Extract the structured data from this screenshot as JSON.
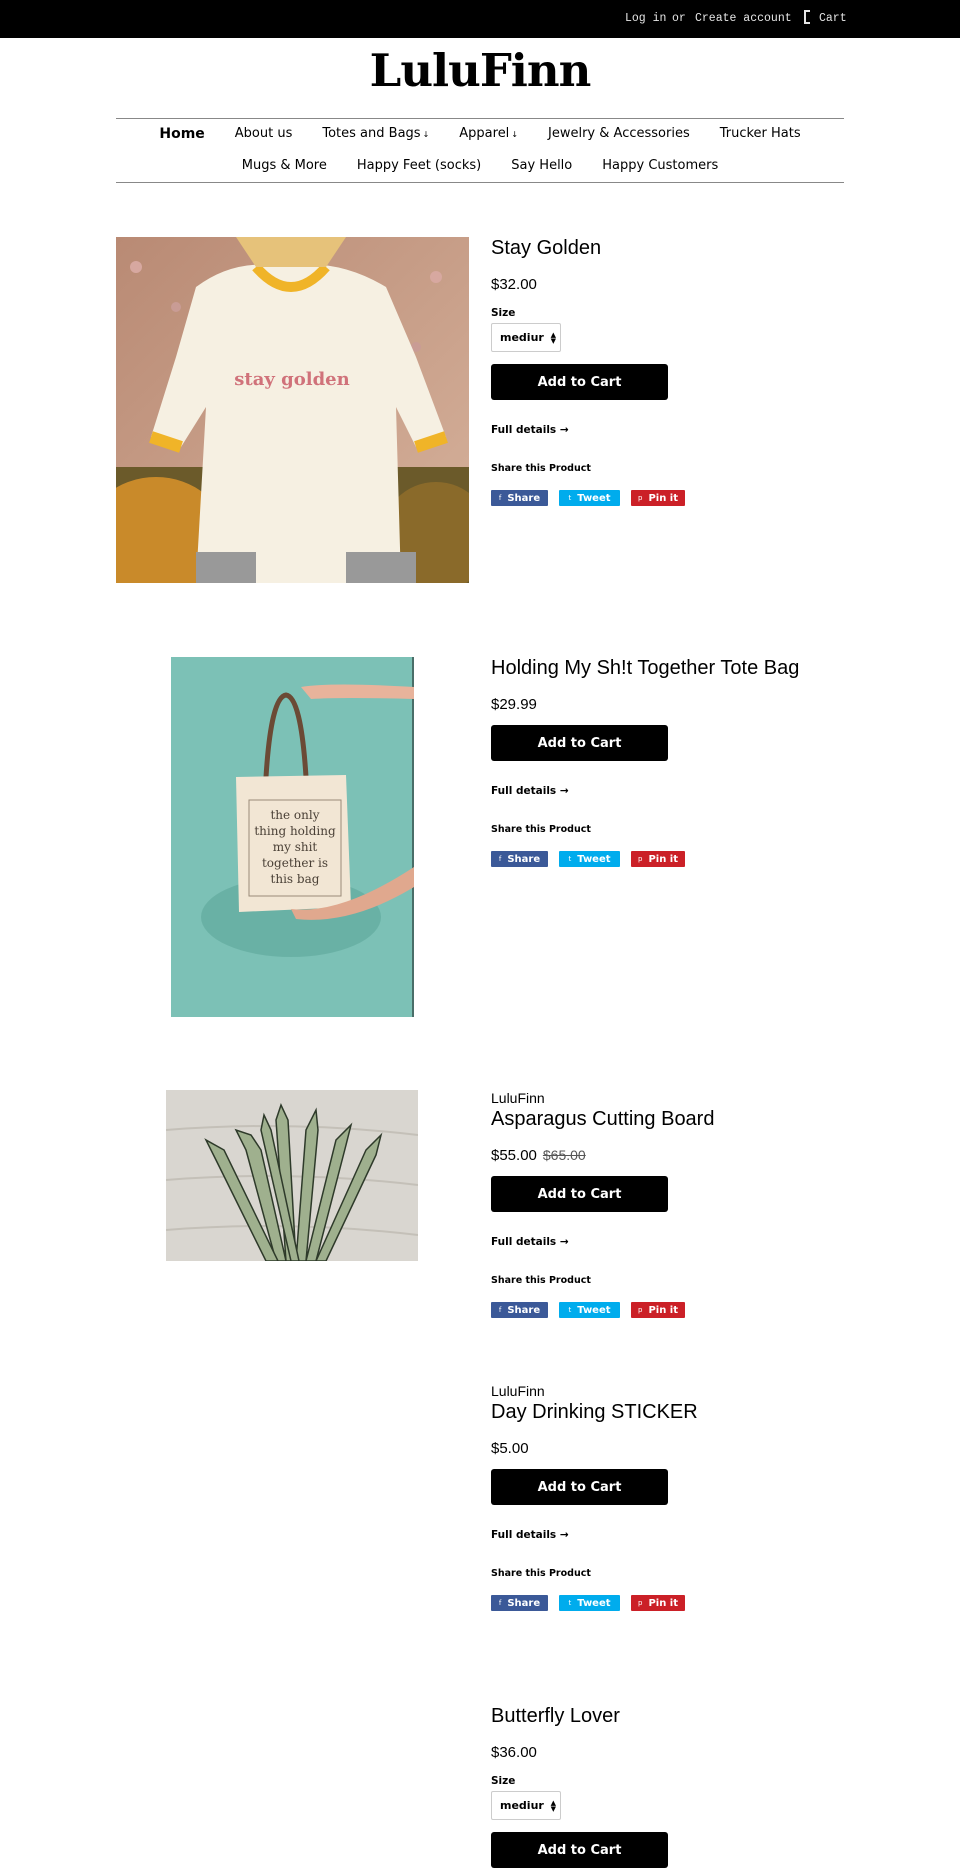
{
  "topbar": {
    "login_label": "Log in",
    "or_label": "or",
    "create_account_label": "Create account",
    "cart_label": "Cart",
    "cart_icon": "cart-bracket-icon"
  },
  "store": {
    "name": "LuluFinn"
  },
  "nav": {
    "row1": [
      {
        "label": "Home",
        "active": true,
        "dropdown": false
      },
      {
        "label": "About us",
        "dropdown": false
      },
      {
        "label": "Totes and Bags",
        "dropdown": true
      },
      {
        "label": "Apparel",
        "dropdown": true
      },
      {
        "label": "Jewelry & Accessories",
        "dropdown": false
      },
      {
        "label": "Trucker Hats",
        "dropdown": false
      }
    ],
    "row2": [
      {
        "label": "Mugs & More"
      },
      {
        "label": "Happy Feet (socks)"
      },
      {
        "label": "Say Hello"
      },
      {
        "label": "Happy Customers"
      }
    ],
    "dropdown_caret": "↓"
  },
  "common": {
    "add_to_cart": "Add to Cart",
    "full_details": "Full details →",
    "share_label": "Share this Product",
    "share_facebook": "Share",
    "share_twitter": "Tweet",
    "share_pinterest": "Pin it",
    "size_label": "Size"
  },
  "products": [
    {
      "title": "Stay Golden",
      "price": "$32.00",
      "has_size": true,
      "size_value": "mediur",
      "image_text": "stay golden"
    },
    {
      "title": "Holding My Sh!t Together Tote Bag",
      "price": "$29.99",
      "image_text": [
        "the only",
        "thing holding",
        "my shit",
        "together is",
        "this bag"
      ]
    },
    {
      "vendor": "LuluFinn",
      "title": "Asparagus Cutting Board",
      "price": "$55.00",
      "compare_price": "$65.00"
    },
    {
      "vendor": "LuluFinn",
      "title": "Day Drinking STICKER",
      "price": "$5.00"
    },
    {
      "title": "Butterfly Lover",
      "price": "$36.00",
      "has_size": true,
      "size_value": "mediur"
    }
  ],
  "colors": {
    "facebook": "#3b5998",
    "twitter": "#00aced",
    "pinterest": "#cb2027",
    "topbar": "#000000"
  }
}
